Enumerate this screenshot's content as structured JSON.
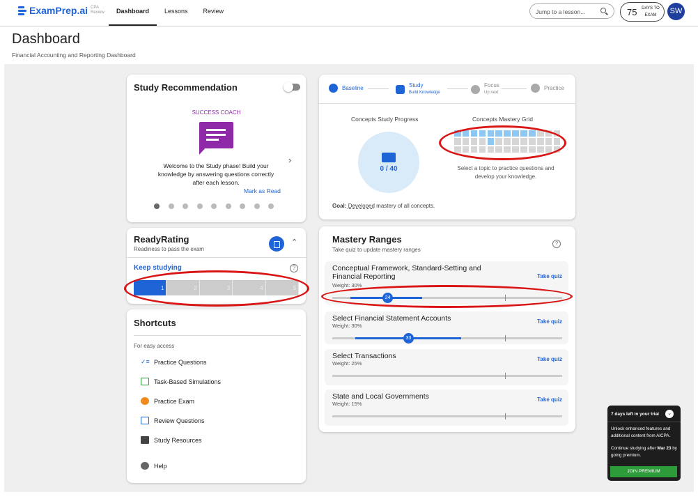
{
  "header": {
    "brand_name": "ExamPrep.ai",
    "brand_sub": "CPA Review",
    "tabs": [
      "Dashboard",
      "Lessons",
      "Review"
    ],
    "search_placeholder": "Jump to a lesson...",
    "days_number": "75",
    "days_label": "DAYS TO EXAM",
    "avatar_initials": "SW",
    "brand_color": "#1f64d6"
  },
  "page": {
    "title": "Dashboard",
    "subtitle": "Financial Accounting and Reporting Dashboard"
  },
  "study_rec": {
    "title": "Study Recommendation",
    "coach_label": "SUCCESS COACH",
    "message": "Welcome to the Study phase! Build your knowledge by answering questions correctly after each lesson.",
    "mark_read": "Mark as Read",
    "dot_count": 9,
    "chevron_icon": "chevron-right-icon",
    "coach_color": "#8e2aa8"
  },
  "ready_rating": {
    "title": "ReadyRating",
    "subtitle": "Readiness to pass the exam",
    "status": "Keep studying",
    "segments": [
      "1",
      "2",
      "3",
      "4",
      "5"
    ],
    "level": 1
  },
  "shortcuts": {
    "title": "Shortcuts",
    "subtitle": "For easy access",
    "items": [
      {
        "label": "Practice Questions",
        "icon": "checklist-icon"
      },
      {
        "label": "Task-Based Simulations",
        "icon": "simulation-icon"
      },
      {
        "label": "Practice Exam",
        "icon": "timer-icon"
      },
      {
        "label": "Review Questions",
        "icon": "review-list-icon"
      },
      {
        "label": "Study Resources",
        "icon": "document-icon"
      }
    ],
    "help": "Help"
  },
  "phases": {
    "steps": [
      {
        "label": "Baseline",
        "sub": ""
      },
      {
        "label": "Study",
        "sub": "Build Knowledge"
      },
      {
        "label": "Focus",
        "sub": "Up next"
      },
      {
        "label": "Practice",
        "sub": ""
      }
    ],
    "progress_title": "Concepts Study Progress",
    "progress_value": "0 / 40",
    "grid_title": "Concepts Mastery Grid",
    "grid_hint": "Select a topic to practice questions and develop your knowledge.",
    "goal_label": "Goal:",
    "goal_highlight": "Developed",
    "goal_rest": "mastery of all concepts.",
    "grid_blue_cells": [
      0,
      1,
      2,
      3,
      4,
      5,
      6,
      7,
      8,
      9,
      17
    ]
  },
  "mastery": {
    "title": "Mastery Ranges",
    "subtitle": "Take quiz to update mastery ranges",
    "take_quiz": "Take quiz",
    "topics": [
      {
        "name": "Conceptual Framework, Standard-Setting and Financial Reporting",
        "weight": "Weight: 30%",
        "score": "24",
        "range": [
          0.08,
          0.39
        ],
        "score_pos": 0.24
      },
      {
        "name": "Select Financial Statement Accounts",
        "weight": "Weight: 30%",
        "score": "33",
        "range": [
          0.1,
          0.56
        ],
        "score_pos": 0.33
      },
      {
        "name": "Select Transactions",
        "weight": "Weight: 25%",
        "score": "",
        "range": null,
        "score_pos": null
      },
      {
        "name": "State and Local Governments",
        "weight": "Weight: 15%",
        "score": "",
        "range": null,
        "score_pos": null
      }
    ],
    "threshold": 0.75
  },
  "trial": {
    "title": "7 days left in your trial",
    "line1": "Unlock enhanced features and additional content from AICPA.",
    "line2a": "Continue studying after ",
    "line2b": "Mar 23",
    "line2c": " by going premium.",
    "button": "JOIN PREMIUM"
  }
}
